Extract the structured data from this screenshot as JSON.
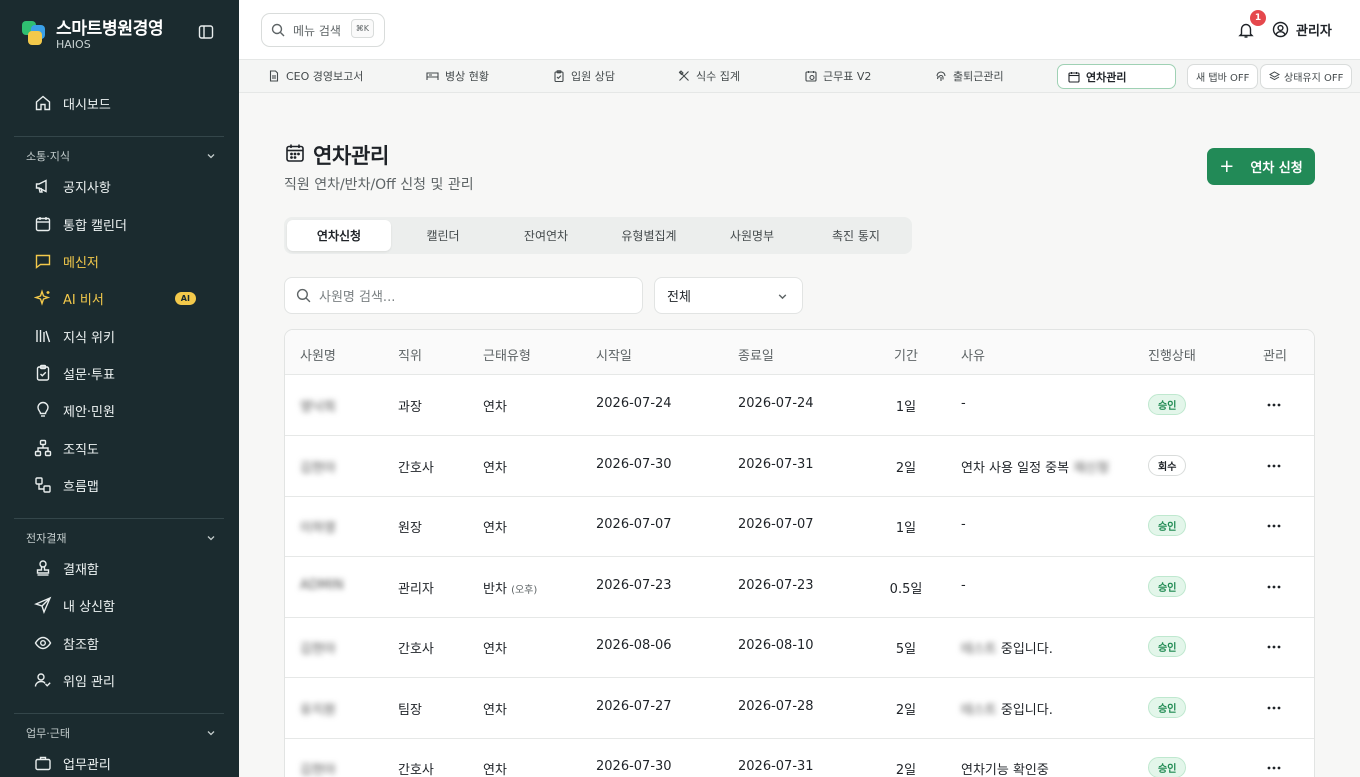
{
  "app": {
    "title": "스마트병원경영",
    "subtitle": "HAIOS"
  },
  "sidebar": {
    "dashboard": "대시보드",
    "sections": [
      {
        "label": "소통·지식",
        "items": [
          {
            "label": "공지사항",
            "icon": "megaphone-icon"
          },
          {
            "label": "통합 캘린더",
            "icon": "calendar-icon"
          },
          {
            "label": "메신저",
            "icon": "chat-icon",
            "active": true
          },
          {
            "label": "AI 비서",
            "icon": "sparkle-icon",
            "active": true,
            "badge": "AI"
          },
          {
            "label": "지식 위키",
            "icon": "library-icon"
          },
          {
            "label": "설문·투표",
            "icon": "clipboard-icon"
          },
          {
            "label": "제안·민원",
            "icon": "lightbulb-icon"
          },
          {
            "label": "조직도",
            "icon": "org-chart-icon"
          },
          {
            "label": "흐름맵",
            "icon": "flow-icon"
          }
        ]
      },
      {
        "label": "전자결재",
        "items": [
          {
            "label": "결재함",
            "icon": "stamp-icon"
          },
          {
            "label": "내 상신함",
            "icon": "send-icon"
          },
          {
            "label": "참조함",
            "icon": "eye-icon"
          },
          {
            "label": "위임 관리",
            "icon": "user-check-icon"
          }
        ]
      },
      {
        "label": "업무·근태",
        "items": [
          {
            "label": "업무관리",
            "icon": "briefcase-icon"
          }
        ]
      }
    ]
  },
  "topbar": {
    "search_placeholder": "메뉴 검색",
    "shortcut": "⌘K",
    "notification_count": "1",
    "user": "관리자"
  },
  "page_tabs": [
    {
      "label": "CEO 경영보고서",
      "icon": "report-icon"
    },
    {
      "label": "병상 현황",
      "icon": "bed-icon"
    },
    {
      "label": "입원 상담",
      "icon": "clipboard-icon"
    },
    {
      "label": "식수 집계",
      "icon": "utensils-icon"
    },
    {
      "label": "근무표 V2",
      "icon": "calendar-clock-icon"
    },
    {
      "label": "출퇴근관리",
      "icon": "fingerprint-icon"
    },
    {
      "label": "연차관리",
      "icon": "calendar-icon",
      "active": true
    }
  ],
  "toggles": {
    "new_tab": "새 탭바 OFF",
    "keep_state": "상태유지 OFF"
  },
  "page": {
    "title": "연차관리",
    "subtitle": "직원 연차/반차/Off 신청 및 관리",
    "primary_action": "연차 신청",
    "tabs": [
      "연차신청",
      "캘린더",
      "잔여연차",
      "유형별집계",
      "사원명부",
      "촉진 통지"
    ],
    "search_placeholder": "사원명 검색...",
    "filter_value": "전체"
  },
  "table": {
    "columns": [
      "사원명",
      "직위",
      "근태유형",
      "시작일",
      "종료일",
      "기간",
      "사유",
      "진행상태",
      "관리"
    ],
    "rows": [
      {
        "name": "영낙희",
        "position": "과장",
        "type": "연차",
        "type_note": "",
        "start": "2026-07-24",
        "end": "2026-07-24",
        "period": "1일",
        "reason_blur": "",
        "reason": "-",
        "status": "승인",
        "status_kind": "approved"
      },
      {
        "name": "김현아",
        "position": "간호사",
        "type": "연차",
        "type_note": "",
        "start": "2026-07-30",
        "end": "2026-07-31",
        "period": "2일",
        "reason_prefix": "연차 사용 일정 중복",
        "reason_blur": "재신청",
        "reason": "",
        "status": "회수",
        "status_kind": "revoked"
      },
      {
        "name": "이하영",
        "position": "원장",
        "type": "연차",
        "type_note": "",
        "start": "2026-07-07",
        "end": "2026-07-07",
        "period": "1일",
        "reason_blur": "",
        "reason": "-",
        "status": "승인",
        "status_kind": "approved"
      },
      {
        "name": "ADMIN",
        "position": "관리자",
        "type": "반차",
        "type_note": "(오후)",
        "start": "2026-07-23",
        "end": "2026-07-23",
        "period": "0.5일",
        "reason_blur": "",
        "reason": "-",
        "status": "승인",
        "status_kind": "approved"
      },
      {
        "name": "김현아",
        "position": "간호사",
        "type": "연차",
        "type_note": "",
        "start": "2026-08-06",
        "end": "2026-08-10",
        "period": "5일",
        "reason_blur": "테스트",
        "reason": "중입니다.",
        "status": "승인",
        "status_kind": "approved"
      },
      {
        "name": "유지원",
        "position": "팀장",
        "type": "연차",
        "type_note": "",
        "start": "2026-07-27",
        "end": "2026-07-28",
        "period": "2일",
        "reason_blur": "테스트",
        "reason": "중입니다.",
        "status": "승인",
        "status_kind": "approved"
      },
      {
        "name": "김현아",
        "position": "간호사",
        "type": "연차",
        "type_note": "",
        "start": "2026-07-30",
        "end": "2026-07-31",
        "period": "2일",
        "reason_blur": "",
        "reason": "연차기능 확인중",
        "status": "승인",
        "status_kind": "approved"
      }
    ]
  },
  "colors": {
    "sidebar_bg": "#1b2b2f",
    "accent_yellow": "#f3c94b",
    "primary_green": "#228a57",
    "approved_bg": "#e3f6ea"
  }
}
